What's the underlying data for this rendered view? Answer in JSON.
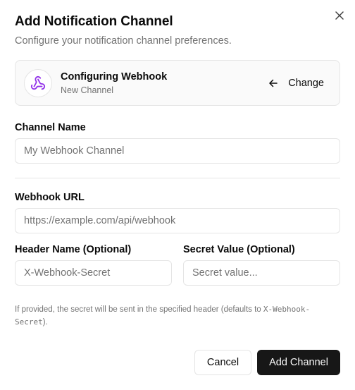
{
  "dialog": {
    "title": "Add Notification Channel",
    "description": "Configure your notification channel preferences.",
    "close_icon": "close-icon"
  },
  "selected_type": {
    "icon": "webhook-icon",
    "icon_color": "#9333ea",
    "title": "Configuring Webhook",
    "subtitle": "New Channel",
    "change_label": "Change",
    "change_icon": "arrow-left-icon"
  },
  "form": {
    "channel_name": {
      "label": "Channel Name",
      "placeholder": "My Webhook Channel",
      "value": ""
    },
    "webhook_url": {
      "label": "Webhook URL",
      "placeholder": "https://example.com/api/webhook",
      "value": ""
    },
    "header_name": {
      "label": "Header Name (Optional)",
      "placeholder": "X-Webhook-Secret",
      "value": ""
    },
    "secret_value": {
      "label": "Secret Value (Optional)",
      "placeholder": "Secret value...",
      "value": ""
    },
    "help_prefix": "If provided, the secret will be sent in the specified header (defaults to ",
    "help_code": "X-Webhook-Secret",
    "help_suffix": ")."
  },
  "footer": {
    "cancel_label": "Cancel",
    "submit_label": "Add Channel"
  }
}
